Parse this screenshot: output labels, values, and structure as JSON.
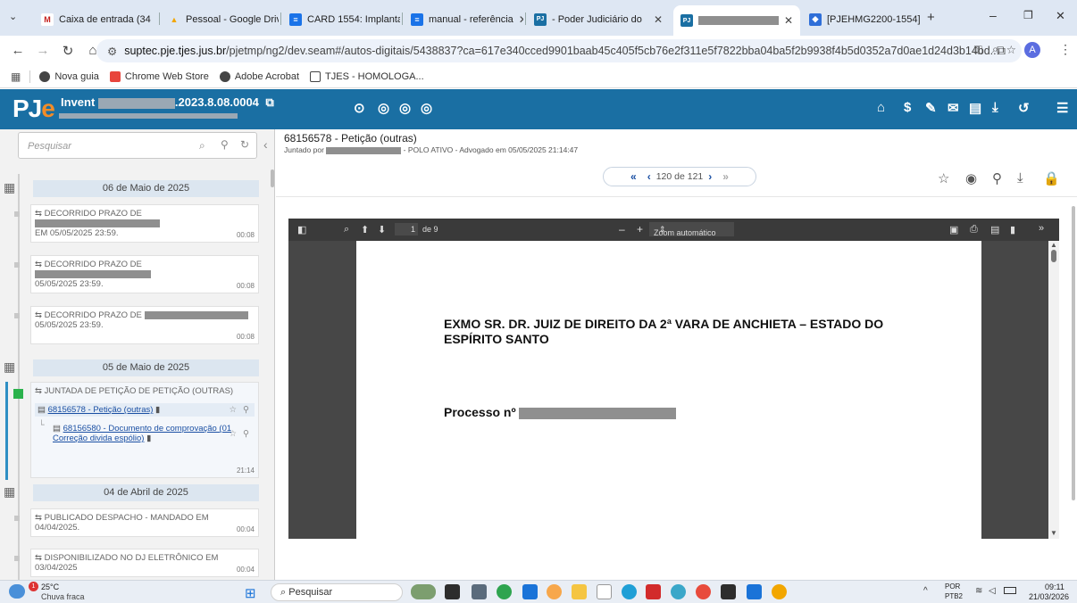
{
  "browser": {
    "tabs": [
      {
        "label": "Caixa de entrada (34",
        "color": "#c5221f",
        "glyph": "M"
      },
      {
        "label": "Pessoal - Google Driv",
        "color": "#f2a600",
        "glyph": "▲"
      },
      {
        "label": "CARD 1554: Implanta",
        "color": "#1a73e8",
        "glyph": "≡"
      },
      {
        "label": "manual - referência",
        "color": "#1a73e8",
        "glyph": "≡"
      },
      {
        "label": "- Poder Judiciário do",
        "color": "#1a6fa3",
        "glyph": "PJ"
      },
      {
        "label": "",
        "color": "#1a6fa3",
        "glyph": "PJ"
      },
      {
        "label": "[PJEHMG2200-1554]",
        "color": "#2f6fd8",
        "glyph": "◆"
      }
    ],
    "new_tab": "+",
    "url_scheme": "suptec.pje.tjes.jus.br",
    "url_path": "/pjetmp/ng2/dev.seam#/autos-digitais/5438837?ca=617e340cced9901baab45c405f5cb76e2f311e5f7822bba04ba5f2b9938f4b5d0352a7d0ae1d24d3b14bd...",
    "profile_initial": "A",
    "bookmarks": [
      "Nova guia",
      "Chrome Web Store",
      "Adobe Acrobat",
      "TJES - HOMOLOGA..."
    ]
  },
  "pje": {
    "logo_p": "PJ",
    "logo_e": "e",
    "process_prefix": "Invent",
    "process_suffix": ".2023.8.08.0004",
    "search_placeholder": "Pesquisar"
  },
  "timeline": {
    "groups": [
      {
        "date": "06 de Maio de 2025"
      },
      {
        "date": "05 de Maio de 2025"
      },
      {
        "date": "04 de Abril de 2025"
      }
    ],
    "items": [
      {
        "title": "DECORRIDO PRAZO DE",
        "line2": "EM 05/05/2025 23:59.",
        "time": "00:08"
      },
      {
        "title": "DECORRIDO PRAZO DE",
        "line2": "05/05/2025 23:59.",
        "time": "00:08"
      },
      {
        "title": "DECORRIDO PRAZO DE",
        "line2": "05/05/2025 23:59.",
        "time": "00:08"
      },
      {
        "title": "JUNTADA DE PETIÇÃO DE PETIÇÃO (OUTRAS)",
        "doc1": "68156578 - Petição (outras)",
        "doc2a": "68156580 - Documento de comprovação (01",
        "doc2b": "Correção divida espólio)",
        "time": "21:14"
      },
      {
        "title": "PUBLICADO DESPACHO - MANDADO EM 04/04/2025.",
        "time": "00:04"
      },
      {
        "title": "DISPONIBILIZADO NO DJ ELETRÔNICO EM 03/04/2025",
        "time": "00:04"
      }
    ]
  },
  "document": {
    "title": "68156578 - Petição (outras)",
    "sub_prefix": "Juntado por",
    "sub_suffix": "- POLO ATIVO - Advogado em 05/05/2025 21:14:47",
    "pager_text": "120 de 121",
    "pdf_page": "1",
    "pdf_of": "de 9",
    "pdf_zoom": "Zoom automático",
    "heading": "EXMO SR. DR. JUIZ DE DIREITO DA 2ª VARA DE ANCHIETA – ESTADO DO ESPÍRITO SANTO",
    "process_label": "Processo nº"
  },
  "taskbar": {
    "temp": "25°C",
    "weather": "Chuva fraca",
    "search": "Pesquisar",
    "lang1": "POR",
    "lang2": "PTB2",
    "time": "09:11",
    "date": "21/03/2026"
  }
}
